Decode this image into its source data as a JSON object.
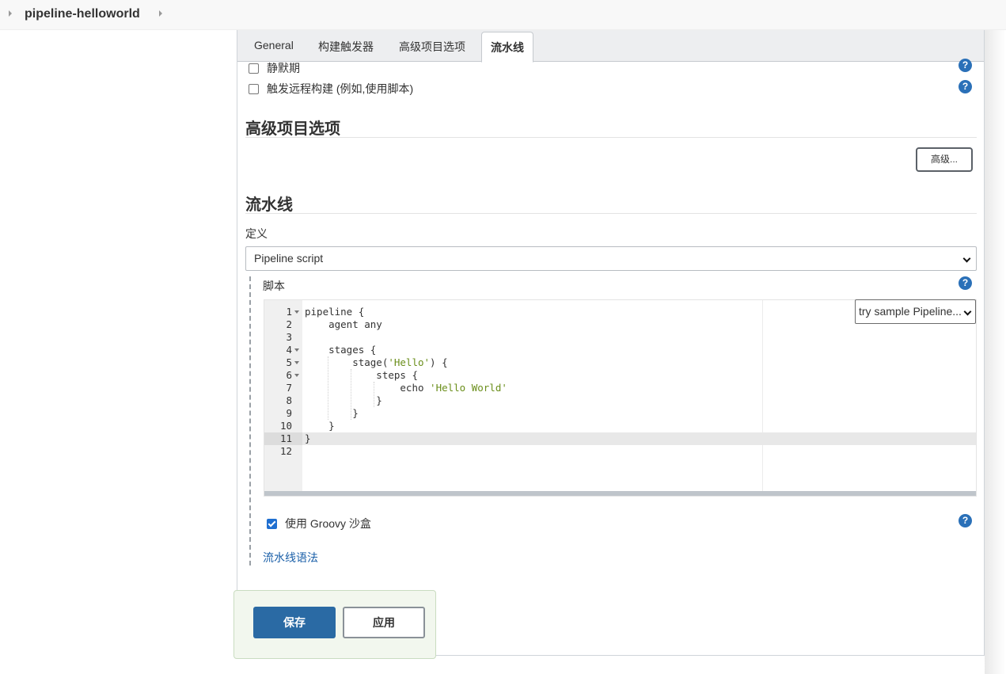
{
  "breadcrumb": {
    "project": "pipeline-helloworld"
  },
  "tabs": [
    {
      "label": "General"
    },
    {
      "label": "构建触发器"
    },
    {
      "label": "高级项目选项"
    },
    {
      "label": "流水线"
    }
  ],
  "triggers": {
    "quiet_period_label": "静默期",
    "remote_build_label": "触发远程构建 (例如,使用脚本)"
  },
  "advanced": {
    "title": "高级项目选项",
    "button": "高级..."
  },
  "pipeline": {
    "title": "流水线",
    "definition_label": "定义",
    "definition_value": "Pipeline script",
    "script_label": "脚本",
    "sample_select": "try sample Pipeline...",
    "code_lines": [
      {
        "num": "1",
        "text": "pipeline {"
      },
      {
        "num": "2",
        "text": "    agent any"
      },
      {
        "num": "3",
        "text": ""
      },
      {
        "num": "4",
        "text": "    stages {"
      },
      {
        "num": "5",
        "pre": "        stage(",
        "str": "'Hello'",
        "post": ") {"
      },
      {
        "num": "6",
        "text": "            steps {"
      },
      {
        "num": "7",
        "pre": "                echo ",
        "str": "'Hello World'",
        "post": ""
      },
      {
        "num": "8",
        "text": "            }"
      },
      {
        "num": "9",
        "text": "        }"
      },
      {
        "num": "10",
        "text": "    }"
      },
      {
        "num": "11",
        "text": "}"
      },
      {
        "num": "12",
        "text": ""
      }
    ],
    "active_line": "11",
    "sandbox_label": "使用 Groovy 沙盒",
    "sandbox_checked": true,
    "syntax_link": "流水线语法"
  },
  "actions": {
    "save": "保存",
    "apply": "应用"
  },
  "help_glyph": "?",
  "colors": {
    "primary": "#2a6aa4",
    "help": "#2a70b8",
    "link": "#1a5fa8",
    "string": "#6a8e1a"
  }
}
